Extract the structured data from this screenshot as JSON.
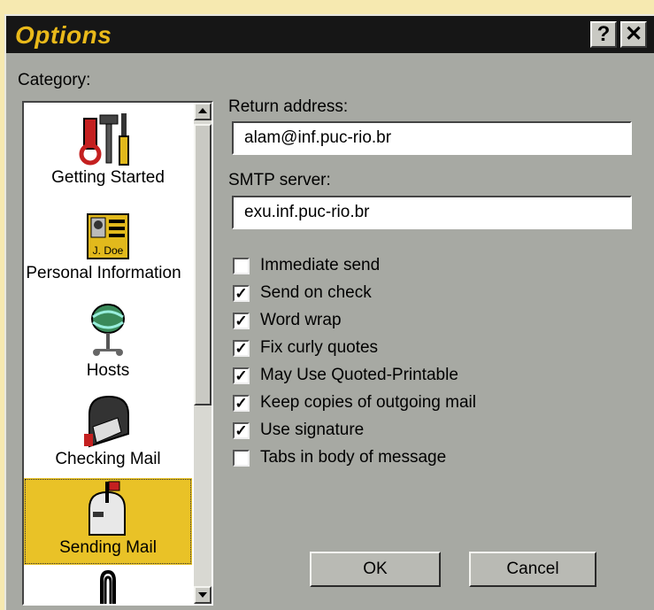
{
  "window": {
    "title": "Options",
    "help_label": "?",
    "close_label": "✕"
  },
  "category": {
    "label": "Category:",
    "items": [
      {
        "label": "Getting Started",
        "icon": "tools-icon",
        "selected": false
      },
      {
        "label": "Personal Information",
        "icon": "id-card-icon",
        "badge": "J. Doe",
        "selected": false
      },
      {
        "label": "Hosts",
        "icon": "globe-network-icon",
        "selected": false
      },
      {
        "label": "Checking Mail",
        "icon": "mailbox-icon",
        "selected": false
      },
      {
        "label": "Sending Mail",
        "icon": "mailbox-flag-up-icon",
        "selected": true
      },
      {
        "label": "",
        "icon": "paperclip-icon",
        "selected": false
      }
    ]
  },
  "form": {
    "return_address_label": "Return address:",
    "return_address_value": "alam@inf.puc-rio.br",
    "smtp_label": "SMTP server:",
    "smtp_value": "exu.inf.puc-rio.br"
  },
  "options": [
    {
      "label": "Immediate send",
      "checked": false
    },
    {
      "label": "Send on check",
      "checked": true
    },
    {
      "label": "Word wrap",
      "checked": true
    },
    {
      "label": "Fix curly quotes",
      "checked": true
    },
    {
      "label": "May Use Quoted-Printable",
      "checked": true
    },
    {
      "label": "Keep copies of outgoing mail",
      "checked": true
    },
    {
      "label": "Use signature",
      "checked": true
    },
    {
      "label": "Tabs in body of message",
      "checked": false
    }
  ],
  "buttons": {
    "ok": "OK",
    "cancel": "Cancel"
  },
  "colors": {
    "title_text": "#e9b91a",
    "selection": "#e9c227",
    "dialog_face": "#a7a9a3"
  }
}
